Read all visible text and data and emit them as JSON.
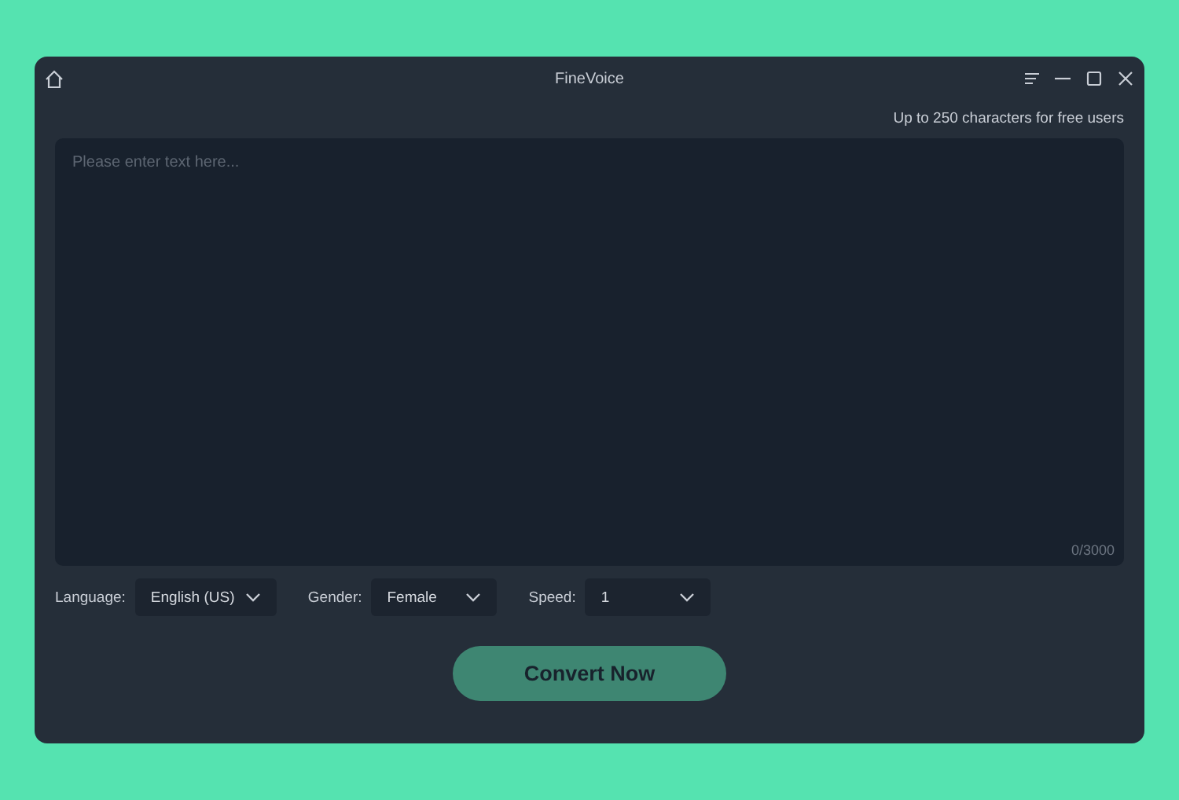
{
  "window": {
    "title": "FineVoice"
  },
  "limit_note": "Up to 250 characters for free users",
  "text_input": {
    "placeholder": "Please enter text here...",
    "counter": "0/3000"
  },
  "selects": [
    {
      "label": "Language:",
      "value": "English (US)"
    },
    {
      "label": "Gender:",
      "value": "Female"
    },
    {
      "label": "Speed:",
      "value": "1"
    }
  ],
  "convert_button": "Convert Now"
}
